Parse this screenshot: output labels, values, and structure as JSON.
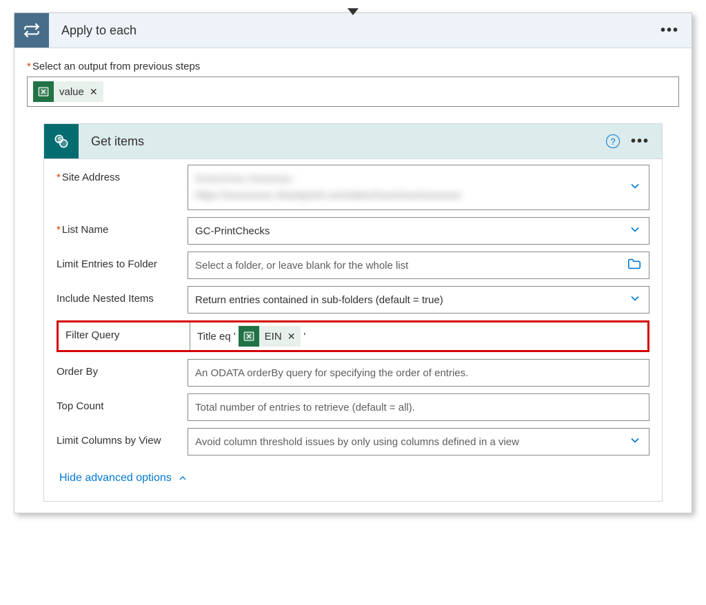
{
  "applyToEach": {
    "title": "Apply to each",
    "selectLabel": "Select an output from previous steps",
    "token": {
      "label": "value",
      "icon": "excel-icon"
    }
  },
  "getItems": {
    "title": "Get items",
    "fields": {
      "siteAddress": {
        "label": "Site Address",
        "value_line1": "XxxxxXxxx Xxxxxxxx -",
        "value_line2": "https://xxxxxxxxx.sharepoint.com/sites/XxxxXxxxXxxxxxxx"
      },
      "listName": {
        "label": "List Name",
        "value": "GC-PrintChecks"
      },
      "limitFolder": {
        "label": "Limit Entries to Folder",
        "placeholder": "Select a folder, or leave blank for the whole list"
      },
      "includeNested": {
        "label": "Include Nested Items",
        "value": "Return entries contained in sub-folders (default = true)"
      },
      "filterQuery": {
        "label": "Filter Query",
        "prefix": "Title eq '",
        "token": {
          "label": "EIN",
          "icon": "excel-icon"
        },
        "suffix": "'"
      },
      "orderBy": {
        "label": "Order By",
        "placeholder": "An ODATA orderBy query for specifying the order of entries."
      },
      "topCount": {
        "label": "Top Count",
        "placeholder": "Total number of entries to retrieve (default = all)."
      },
      "limitColumns": {
        "label": "Limit Columns by View",
        "placeholder": "Avoid column threshold issues by only using columns defined in a view"
      }
    },
    "hideAdvanced": "Hide advanced options"
  }
}
